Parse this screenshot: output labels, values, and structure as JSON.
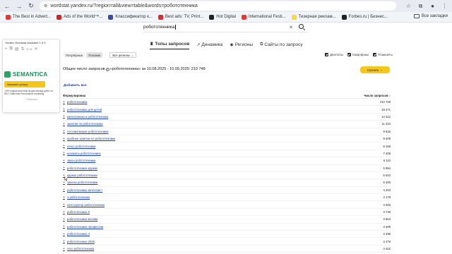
{
  "browser": {
    "url": "wordstat.yandex.ru/?region=all&view=table&words=робототехника",
    "bookmarks": [
      {
        "label": "The Best in Advert...",
        "color": "#e53935"
      },
      {
        "label": "Ads of the World™...",
        "color": "#c62828"
      },
      {
        "label": "Классификатор к...",
        "color": "#3949ab"
      },
      {
        "label": "Best ads: TV, Print...",
        "color": "#d32f2f"
      },
      {
        "label": "Hot Digital",
        "color": "#212121"
      },
      {
        "label": "International Festi...",
        "color": "#e53935"
      },
      {
        "label": "Тизерная реклам...",
        "color": "#fdd835"
      },
      {
        "label": "Forbes.ru | Бизнес...",
        "color": "#212121"
      }
    ],
    "all_bookmarks": "Все закладки"
  },
  "extension": {
    "title": "Yandex Wordstat Assistant 1.9.3",
    "counter": "0 / 0",
    "ad_logo": "SEMANTICA",
    "ad_button": "Заказать услугу",
    "ad_desc": "-30% новым клиентам на две месяца работ по SEO, SMM или Performance marketing",
    "hide": "↑ Свернуть"
  },
  "search": {
    "value": "робототехника"
  },
  "tabs": [
    {
      "label": "Топы запросов",
      "icon": "♜",
      "active": true
    },
    {
      "label": "Динамика",
      "icon": "↗",
      "active": false
    },
    {
      "label": "Регионы",
      "icon": "◉",
      "active": false
    },
    {
      "label": "Сайты по запросу",
      "icon": "⧉",
      "active": false
    }
  ],
  "filters": {
    "popular": "Популярные",
    "similar": "Похожие",
    "regions": "Все регионы",
    "devices": [
      "Десктопы",
      "Смартфоны",
      "Планшеты"
    ]
  },
  "summary": {
    "prefix": "Общее число запросов",
    "rest": "«робототехника» за 10.08.2025 - 10.09.2025: 210 748"
  },
  "download": "Скачать",
  "add_all": "Добавить все",
  "table": {
    "col_phrase": "Формулировка",
    "col_count": "Число запросов ↕",
    "rows": [
      {
        "phrase": "робототехника",
        "count": "210 748"
      },
      {
        "phrase": "робототехника для детей",
        "count": "18 471"
      },
      {
        "phrase": "мехатроника и робототехника",
        "count": "14 312"
      },
      {
        "phrase": "занятия по робототехнике",
        "count": "11 010"
      },
      {
        "phrase": "составляющие робототехники",
        "count": "9 832"
      },
      {
        "phrase": "пробное занятие по робототехнике",
        "count": "9 309"
      },
      {
        "phrase": "класс робототехники",
        "count": "8 159"
      },
      {
        "phrase": "шахматы робототехника",
        "count": "7 408"
      },
      {
        "phrase": "закон робототехники",
        "count": "6 110"
      },
      {
        "phrase": "робототехника кружки",
        "count": "5 954"
      },
      {
        "phrase": "кружок робототехники",
        "count": "5 943"
      },
      {
        "phrase": "законы робототехники",
        "count": "5 400"
      },
      {
        "phrase": "робототехника интенсив г",
        "count": "4 203"
      },
      {
        "phrase": "1 робототехника",
        "count": "4 178"
      },
      {
        "phrase": "конструктор робототехника",
        "count": "4 093"
      },
      {
        "phrase": "робототехника 5",
        "count": "3 748"
      },
      {
        "phrase": "робототехника москва",
        "count": "3 564"
      },
      {
        "phrase": "робототехника профессии",
        "count": "3 499"
      },
      {
        "phrase": "робототехника 4",
        "count": "3 498"
      },
      {
        "phrase": "робототехника 2025",
        "count": "3 479"
      },
      {
        "phrase": "лего робототехника",
        "count": "3 402"
      }
    ]
  }
}
